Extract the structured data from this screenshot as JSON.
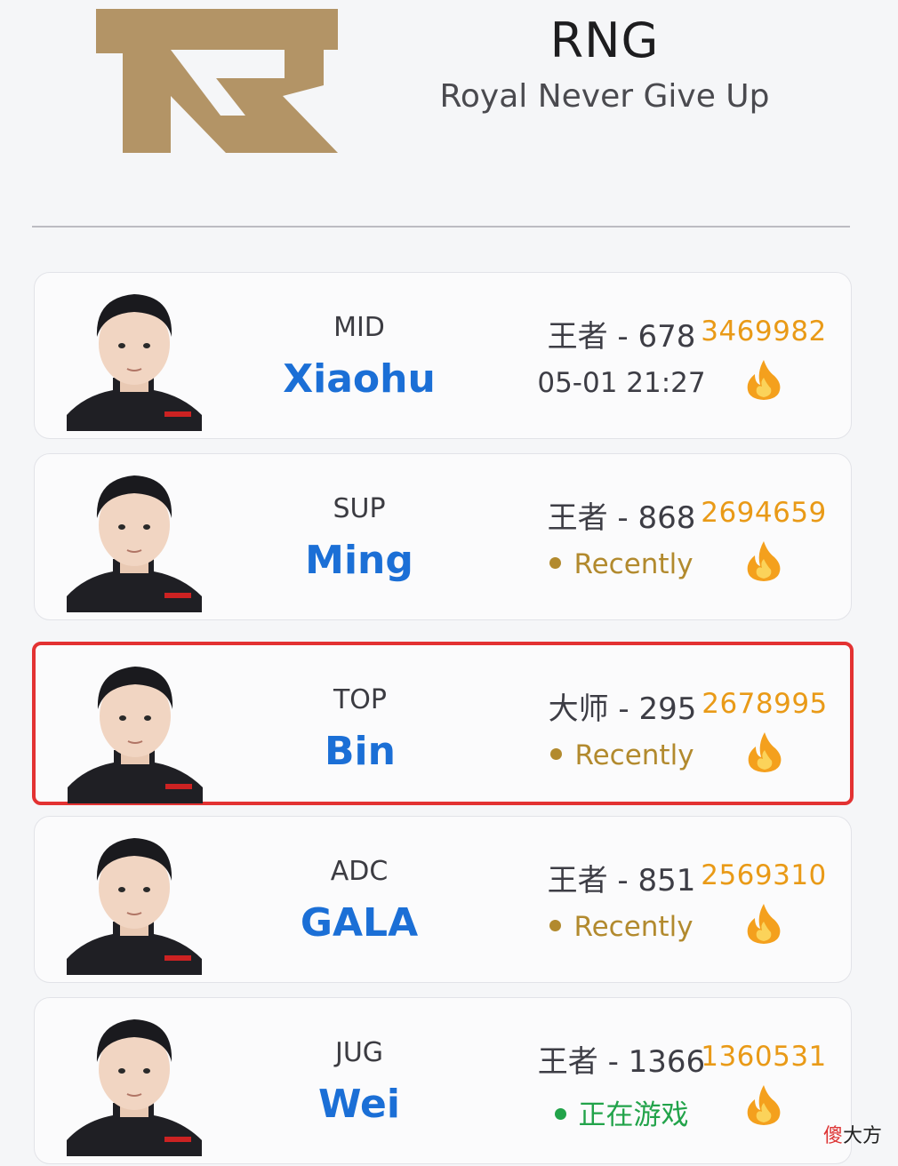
{
  "header": {
    "team_abbr": "RNG",
    "team_full_name": "Royal Never Give Up",
    "logo_color": "#b39466"
  },
  "players": [
    {
      "role": "MID",
      "name": "Xiaohu",
      "rank": "王者 - 678",
      "status": "05-01 21:27",
      "status_type": "time",
      "score": "3469982",
      "selected": false
    },
    {
      "role": "SUP",
      "name": "Ming",
      "rank": "王者 - 868",
      "status": "Recently",
      "status_type": "recent",
      "score": "2694659",
      "selected": false
    },
    {
      "role": "TOP",
      "name": "Bin",
      "rank": "大师 - 295",
      "status": "Recently",
      "status_type": "recent",
      "score": "2678995",
      "selected": true
    },
    {
      "role": "ADC",
      "name": "GALA",
      "rank": "王者 - 851",
      "status": "Recently",
      "status_type": "recent",
      "score": "2569310",
      "selected": false
    },
    {
      "role": "JUG",
      "name": "Wei",
      "rank": "王者 - 1366",
      "status": "正在游戏",
      "status_type": "live",
      "score": "1360531",
      "selected": false
    }
  ],
  "watermark": {
    "first": "傻",
    "rest": "大方"
  },
  "colors": {
    "name_blue": "#1b6fd6",
    "score_orange": "#e99a17",
    "recent_gold": "#b28a2e",
    "live_green": "#22a34a",
    "selected_border": "#e33232"
  },
  "icons": {
    "hot": "fire-icon",
    "player": "player-avatar"
  }
}
